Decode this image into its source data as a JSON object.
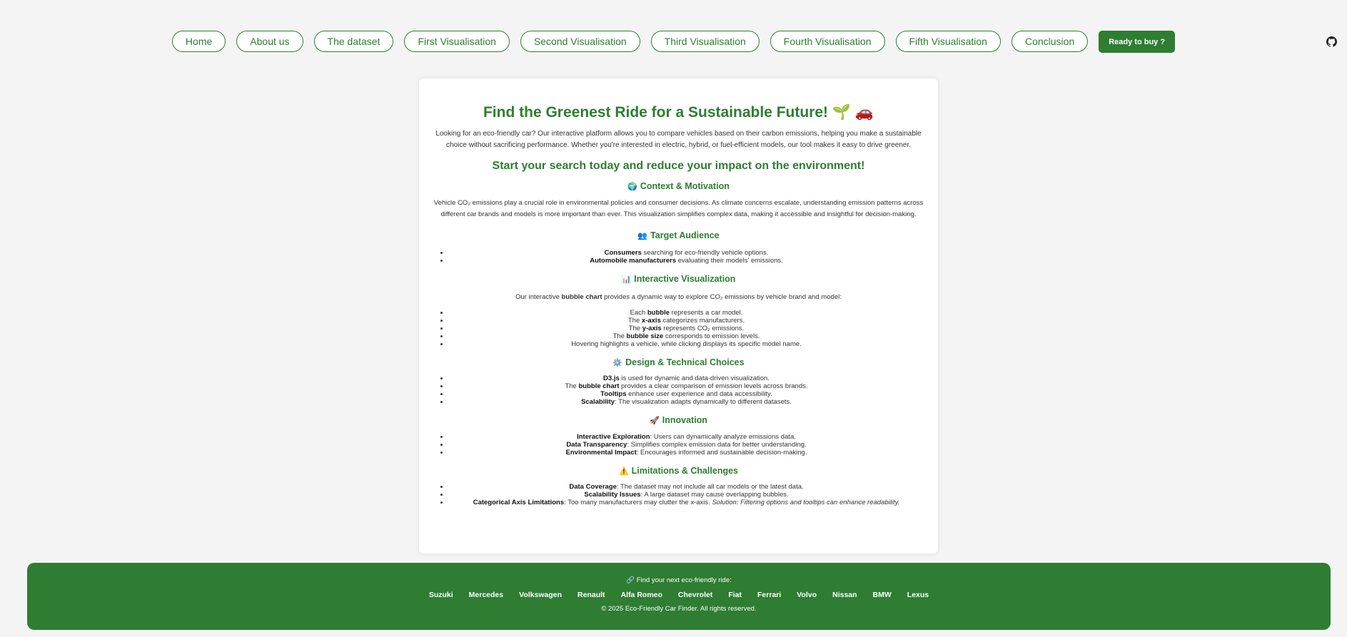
{
  "nav": {
    "items": [
      "Home",
      "About us",
      "The dataset",
      "First Visualisation",
      "Second Visualisation",
      "Third Visualisation",
      "Fourth Visualisation",
      "Fifth Visualisation",
      "Conclusion"
    ],
    "buy_label": "Ready to buy ?",
    "github_icon": "github-icon"
  },
  "main": {
    "title": "Find the Greenest Ride for a Sustainable Future! 🌱 🚗",
    "intro": "Looking for an eco-friendly car? Our interactive platform allows you to compare vehicles based on their carbon emissions, helping you make a sustainable choice without sacrificing performance. Whether you're interested in electric, hybrid, or fuel-efficient models, our tool makes it easy to drive greener.",
    "cta": "Start your search today and reduce your impact on the environment!",
    "context": {
      "icon": "🌍",
      "heading": "Context & Motivation",
      "text": "Vehicle CO₂ emissions play a crucial role in environmental policies and consumer decisions. As climate concerns escalate, understanding emission patterns across different car brands and models is more important than ever. This visualization simplifies complex data, making it accessible and insightful for decision-making."
    },
    "audience": {
      "icon": "👥",
      "heading": "Target Audience",
      "items": [
        {
          "bold": "Consumers",
          "rest": " searching for eco-friendly vehicle options."
        },
        {
          "bold": "Automobile manufacturers",
          "rest": " evaluating their models' emissions."
        }
      ]
    },
    "interactive": {
      "icon": "📊",
      "heading": "Interactive Visualization",
      "text_pre": "Our interactive ",
      "text_bold": "bubble chart",
      "text_post": " provides a dynamic way to explore CO₂ emissions by vehicle brand and model:",
      "items": [
        {
          "pre": "Each ",
          "bold": "bubble",
          "rest": " represents a car model."
        },
        {
          "pre": "The ",
          "bold": "x-axis",
          "rest": " categorizes manufacturers."
        },
        {
          "pre": "The ",
          "bold": "y-axis",
          "rest": " represents CO₂ emissions."
        },
        {
          "pre": "The ",
          "bold": "bubble size",
          "rest": " corresponds to emission levels."
        },
        {
          "pre": "",
          "bold": "",
          "rest": "Hovering highlights a vehicle, while clicking displays its specific model name."
        }
      ]
    },
    "design": {
      "icon": "⚙️",
      "heading": "Design & Technical Choices",
      "items": [
        {
          "pre": "",
          "bold": "D3.js",
          "rest": " is used for dynamic and data-driven visualization."
        },
        {
          "pre": "The ",
          "bold": "bubble chart",
          "rest": " provides a clear comparison of emission levels across brands."
        },
        {
          "pre": "",
          "bold": "Tooltips",
          "rest": " enhance user experience and data accessibility."
        },
        {
          "pre": "",
          "bold": "Scalability",
          "rest": ": The visualization adapts dynamically to different datasets."
        }
      ]
    },
    "innovation": {
      "icon": "🚀",
      "heading": "Innovation",
      "items": [
        {
          "bold": "Interactive Exploration",
          "rest": ": Users can dynamically analyze emissions data."
        },
        {
          "bold": "Data Transparency",
          "rest": ": Simplifies complex emission data for better understanding."
        },
        {
          "bold": "Environmental Impact",
          "rest": ": Encourages informed and sustainable decision-making."
        }
      ]
    },
    "limitations": {
      "icon": "⚠️",
      "heading": "Limitations & Challenges",
      "items": [
        {
          "bold": "Data Coverage",
          "rest": ": The dataset may not include all car models or the latest data.",
          "italic": ""
        },
        {
          "bold": "Scalability Issues",
          "rest": ": A large dataset may cause overlapping bubbles.",
          "italic": ""
        },
        {
          "bold": "Categorical Axis Limitations",
          "rest": ": Too many manufacturers may clutter the x-axis. ",
          "italic": "Solution: Filtering options and tooltips can enhance readability."
        }
      ]
    }
  },
  "footer": {
    "title": "🔗 Find your next eco-friendly ride:",
    "brands": [
      "Suzuki",
      "Mercedes",
      "Volkswagen",
      "Renault",
      "Alfa Romeo",
      "Chevrolet",
      "Fiat",
      "Ferrari",
      "Volvo",
      "Nissan",
      "BMW",
      "Lexus"
    ],
    "copyright": "© 2025 Eco-Friendly Car Finder. All rights reserved."
  },
  "colors": {
    "brand_green": "#2e7d32",
    "background": "#f4f4f4"
  }
}
